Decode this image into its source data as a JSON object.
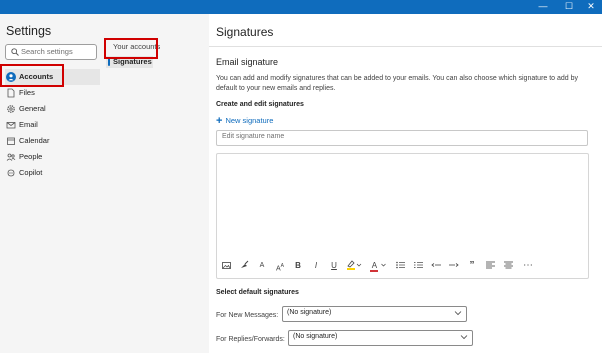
{
  "window": {
    "minimize": "—",
    "maximize": "☐",
    "close": "✕"
  },
  "settings": {
    "title": "Settings",
    "search_placeholder": "Search settings"
  },
  "nav": [
    {
      "label": "Accounts",
      "icon": "person-icon",
      "active": true
    },
    {
      "label": "Files",
      "icon": "file-icon"
    },
    {
      "label": "General",
      "icon": "gear-icon"
    },
    {
      "label": "Email",
      "icon": "mail-icon"
    },
    {
      "label": "Calendar",
      "icon": "calendar-icon"
    },
    {
      "label": "People",
      "icon": "people-icon"
    },
    {
      "label": "Copilot",
      "icon": "copilot-icon"
    }
  ],
  "subnav": {
    "title": "Your accounts",
    "items": [
      {
        "label": "Signatures",
        "active": true
      }
    ]
  },
  "main": {
    "title": "Signatures",
    "section_title": "Email signature",
    "description": "You can add and modify signatures that can be added to your emails. You can also choose which signature to add by default to your new emails and replies.",
    "create_title": "Create and edit signatures",
    "new_signature": "New signature",
    "name_placeholder": "Edit signature name",
    "default_title": "Select default signatures",
    "new_messages_label": "For New Messages:",
    "new_messages_value": "(No signature)",
    "replies_label": "For Replies/Forwards:",
    "replies_value": "(No signature)"
  },
  "toolbar": {
    "bold": "B",
    "italic": "I",
    "underline": "U",
    "font_color": "A",
    "quote": "”",
    "more": "⋯",
    "font_size": "A",
    "superscript_letter": "A",
    "superscript_mark": "A"
  },
  "colors": {
    "accent": "#0f6cbd",
    "highlight": "#ffd400",
    "font_color": "#d13438",
    "annotation": "#d00000"
  }
}
